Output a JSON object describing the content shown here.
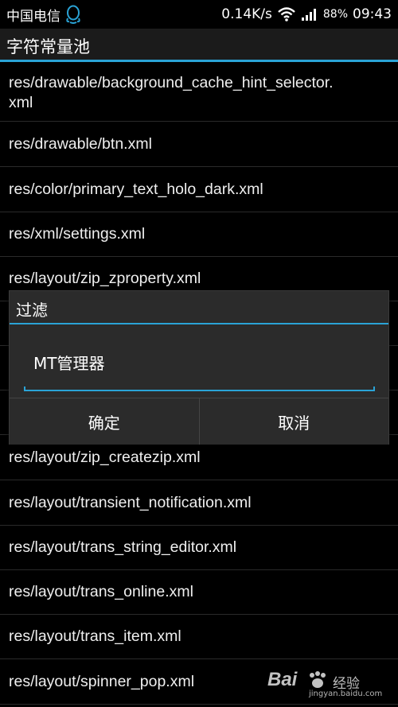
{
  "status_bar": {
    "carrier": "中国电信",
    "network_speed": "0.14K/s",
    "battery": "88%",
    "time": "09:43",
    "icons": [
      "qq-icon",
      "wifi-icon",
      "signal-icon"
    ]
  },
  "title_bar": {
    "title": "字符常量池",
    "accent_color": "#2aa3d6"
  },
  "list": {
    "items": [
      "res/drawable/background_cache_hint_selector.\nxml",
      "res/drawable/btn.xml",
      "res/color/primary_text_holo_dark.xml",
      "res/xml/settings.xml",
      "res/layout/zip_zproperty.xml",
      "res/layout/zip_createzip.xml",
      "res/layout/transient_notification.xml",
      "res/layout/trans_string_editor.xml",
      "res/layout/trans_online.xml",
      "res/layout/trans_item.xml",
      "res/layout/spinner_pop.xml"
    ]
  },
  "dialog": {
    "title": "过滤",
    "input_value": "MT管理器",
    "confirm_label": "确定",
    "cancel_label": "取消"
  },
  "watermark": {
    "logo": "Bai",
    "text": "经验",
    "url": "jingyan.baidu.com"
  }
}
